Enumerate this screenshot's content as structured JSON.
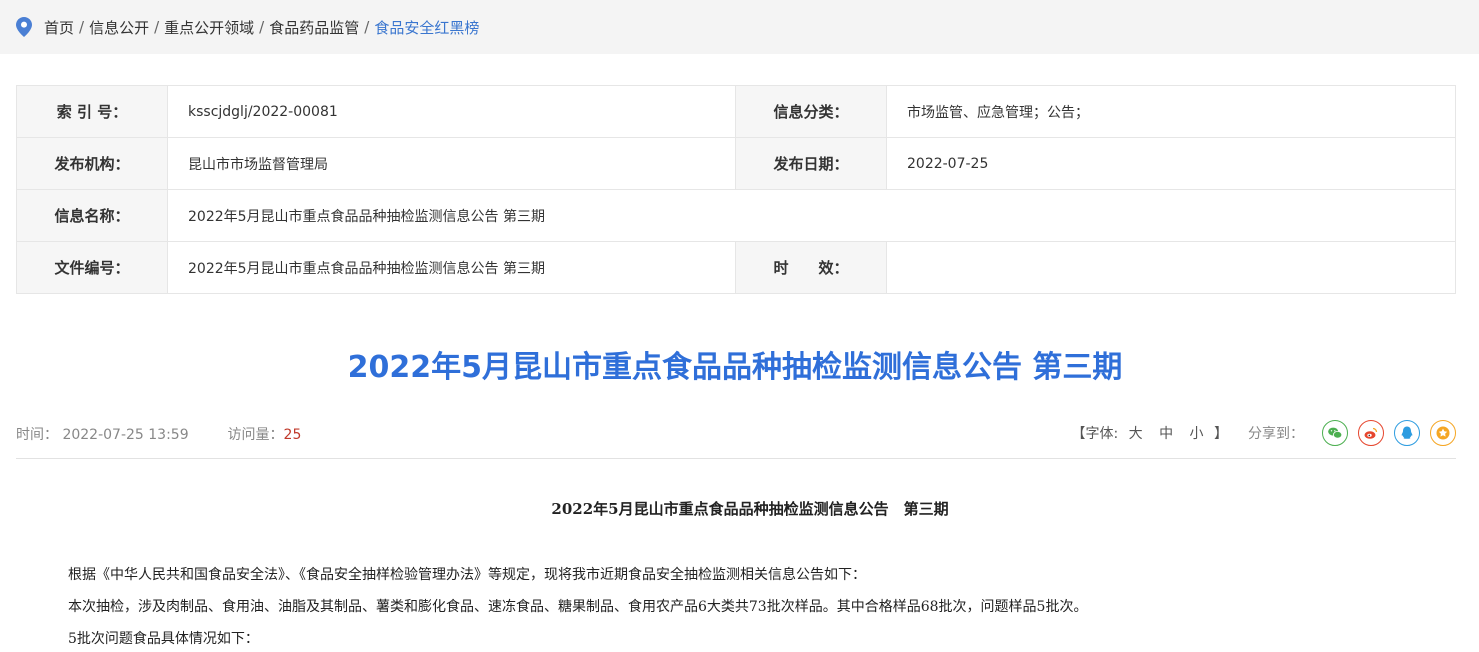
{
  "breadcrumb": {
    "items": [
      "首页",
      "信息公开",
      "重点公开领域",
      "食品药品监管"
    ],
    "current": "食品安全红黑榜",
    "separator": "/"
  },
  "info_table": {
    "index_label": "索 引 号：",
    "index_value": "ksscjdglj/2022-00081",
    "category_label": "信息分类：",
    "category_value": "市场监管、应急管理；公告；",
    "publisher_label": "发布机构：",
    "publisher_value": "昆山市市场监督管理局",
    "date_label": "发布日期：",
    "date_value": "2022-07-25",
    "name_label": "信息名称：",
    "name_value": "2022年5月昆山市重点食品品种抽检监测信息公告 第三期",
    "docno_label": "文件编号：",
    "docno_value": "2022年5月昆山市重点食品品种抽检监测信息公告 第三期",
    "validity_label": "时　　效：",
    "validity_value": ""
  },
  "article": {
    "title": "2022年5月昆山市重点食品品种抽检监测信息公告 第三期",
    "time_label": "时间：",
    "time_value": "2022-07-25 13:59",
    "visits_label": "访问量：",
    "visits_value": "25",
    "font_open": "【字体:",
    "font_large": "大",
    "font_medium": "中",
    "font_small": "小",
    "font_close": "】",
    "share_label": "分享到：",
    "doc_heading": "2022年5月昆山市重点食品品种抽检监测信息公告　第三期",
    "paragraphs": [
      "根据《中华人民共和国食品安全法》、《食品安全抽样检验管理办法》等规定，现将我市近期食品安全抽检监测相关信息公告如下：",
      "本次抽检，涉及肉制品、食用油、油脂及其制品、薯类和膨化食品、速冻食品、糖果制品、食用农产品6大类共73批次样品。其中合格样品68批次，问题样品5批次。",
      "5批次问题食品具体情况如下："
    ]
  },
  "share_icons": [
    {
      "name": "wechat-icon",
      "color": "#4caf50"
    },
    {
      "name": "weibo-icon",
      "color": "#e6462e"
    },
    {
      "name": "qq-icon",
      "color": "#2d9ce0"
    },
    {
      "name": "favorite-star-icon",
      "color": "#f5a623"
    }
  ]
}
